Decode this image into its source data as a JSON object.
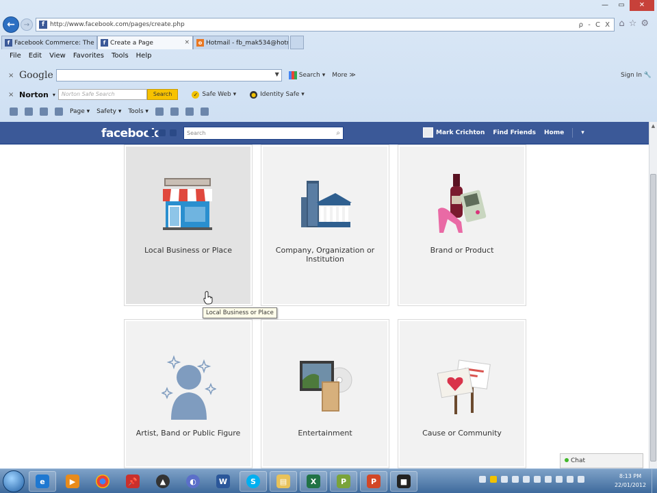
{
  "browser": {
    "url": "http://www.facebook.com/pages/create.php",
    "address_icons": "ρ - C X",
    "tabs": [
      {
        "label": "Facebook Commerce: The Beg...",
        "active": false,
        "favicon": "facebook-icon"
      },
      {
        "label": "Create a Page",
        "active": true,
        "favicon": "facebook-icon"
      },
      {
        "label": "Hotmail - fb_mak534@hotmail...",
        "active": false,
        "favicon": "hotmail-icon"
      }
    ],
    "tab_close": "×",
    "menu": [
      "File",
      "Edit",
      "View",
      "Favorites",
      "Tools",
      "Help"
    ],
    "google_toolbar": {
      "logo": "Google",
      "search_label": "Search",
      "more_label": "More ≫",
      "sign_in": "Sign In"
    },
    "norton_toolbar": {
      "logo": "Norton",
      "search_placeholder": "Norton Safe Search",
      "search_button": "Search",
      "safe_web": "Safe Web ▾",
      "identity_safe": "Identity Safe ▾"
    },
    "command_bar": {
      "page": "Page ▾",
      "safety": "Safety ▾",
      "tools": "Tools ▾"
    }
  },
  "facebook": {
    "logo": "facebook",
    "search_placeholder": "Search",
    "user_name": "Mark Crichton",
    "find_friends": "Find Friends",
    "home": "Home",
    "account_menu": "▾"
  },
  "categories": [
    {
      "label": "Local Business or Place",
      "icon": "storefront-icon",
      "hovered": true
    },
    {
      "label": "Company, Organization or Institution",
      "icon": "office-buildings-icon",
      "hovered": false
    },
    {
      "label": "Brand or Product",
      "icon": "products-icon",
      "hovered": false
    },
    {
      "label": "Artist, Band or Public Figure",
      "icon": "public-figure-icon",
      "hovered": false
    },
    {
      "label": "Entertainment",
      "icon": "entertainment-icon",
      "hovered": false
    },
    {
      "label": "Cause or Community",
      "icon": "cause-signs-icon",
      "hovered": false
    }
  ],
  "tooltip": "Local Business or Place",
  "chat": {
    "label": "Chat"
  },
  "taskbar": {
    "apps": [
      "internet-explorer-icon",
      "media-player-icon",
      "chrome-icon",
      "pin-icon",
      "inkscape-icon",
      "firefox-icon",
      "word-icon",
      "skype-icon",
      "explorer-icon",
      "excel-icon",
      "publisher-icon",
      "powerpoint-icon",
      "camera-icon"
    ],
    "time": "8:13 PM",
    "date": "22/01/2012"
  },
  "colors": {
    "facebook_blue": "#3b5998",
    "card_bg": "#f2f2f2",
    "card_hover_bg": "#e3e3e3"
  }
}
